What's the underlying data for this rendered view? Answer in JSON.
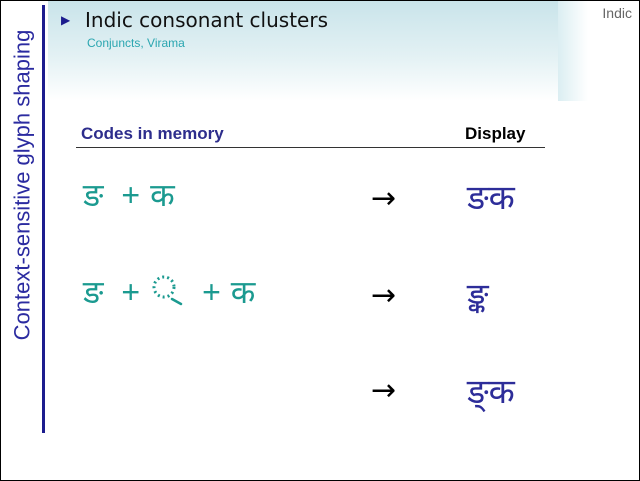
{
  "slide": {
    "section_tag": "Indic",
    "vertical_title": "Context-sensitive glyph shaping",
    "title": "Indic consonant clusters",
    "subtitle": "Conjuncts, Virama",
    "columns": {
      "codes": "Codes in memory",
      "display": "Display"
    },
    "rows": [
      {
        "char1": "ङ",
        "plus1": "+",
        "char2": "क",
        "arrow": "→",
        "result": "ङक"
      },
      {
        "char1": "ङ",
        "plus1": "+",
        "virama": "्",
        "plus2": "+",
        "char2": "क",
        "arrow": "→",
        "result": "ङ्क"
      },
      {
        "arrow": "→",
        "result": "ङ्‌क"
      }
    ]
  },
  "colors": {
    "accent_dark_blue": "#1c1c8e",
    "sequence_teal": "#1b9a90",
    "result_blue": "#2d2d99",
    "subtitle_teal": "#2aa6b0",
    "header_gradient_start": "#c9e4ea"
  }
}
